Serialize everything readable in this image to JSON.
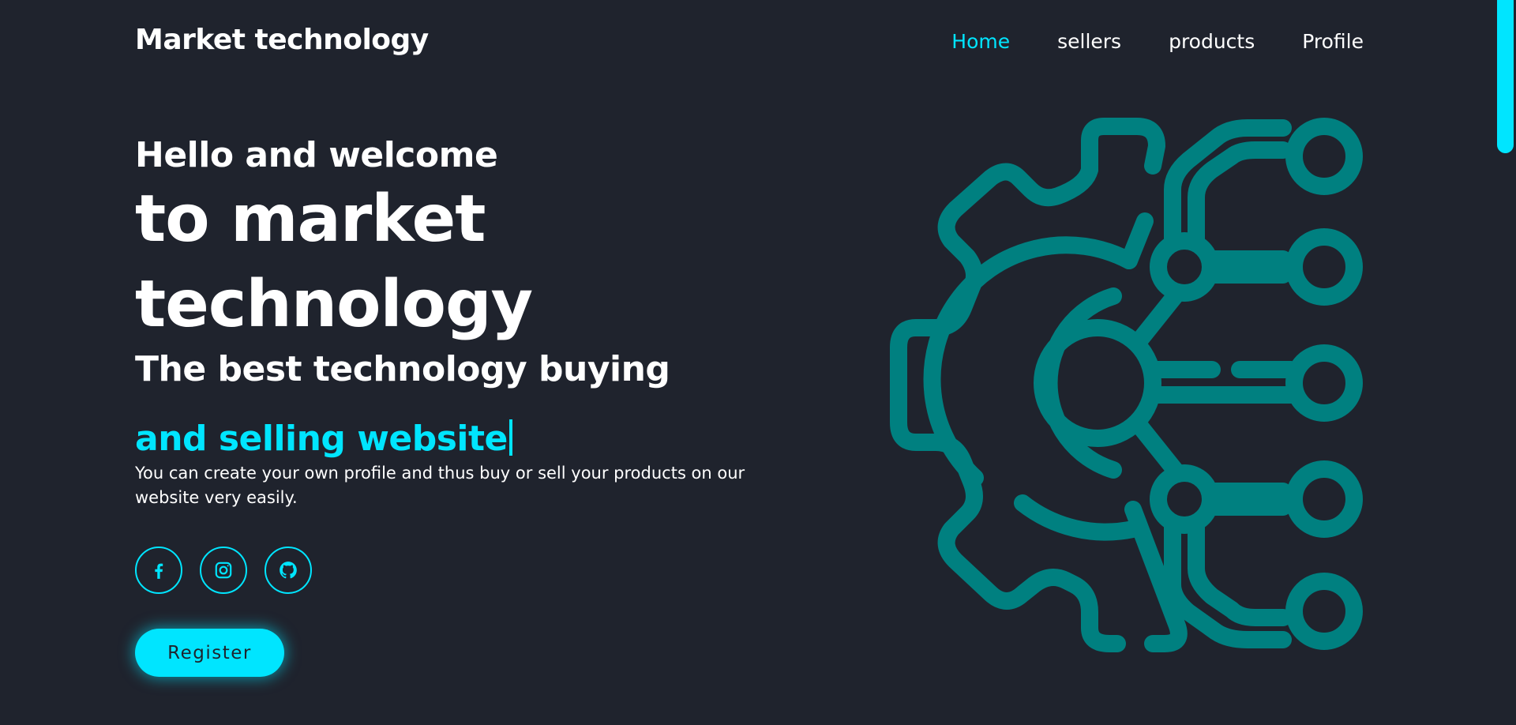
{
  "header": {
    "logo": "Market technology",
    "nav": [
      {
        "label": "Home",
        "active": true
      },
      {
        "label": "sellers",
        "active": false
      },
      {
        "label": "products",
        "active": false
      },
      {
        "label": "Profile",
        "active": false
      }
    ]
  },
  "hero": {
    "greeting": "Hello and welcome",
    "title_line1": "to market",
    "title_line2": "technology",
    "subtitle": "The best technology buying",
    "typed_text": "and selling website",
    "description": "You can create your own profile and thus buy or sell your products on our website very easily.",
    "register_label": "Register"
  },
  "socials": [
    {
      "icon": "facebook-icon"
    },
    {
      "icon": "instagram-icon"
    },
    {
      "icon": "github-icon"
    }
  ],
  "illustration": {
    "icon": "gear-circuit-icon"
  },
  "colors": {
    "background": "#1f232d",
    "accent": "#00e5ff",
    "illustration": "#008080",
    "text": "#ffffff"
  }
}
